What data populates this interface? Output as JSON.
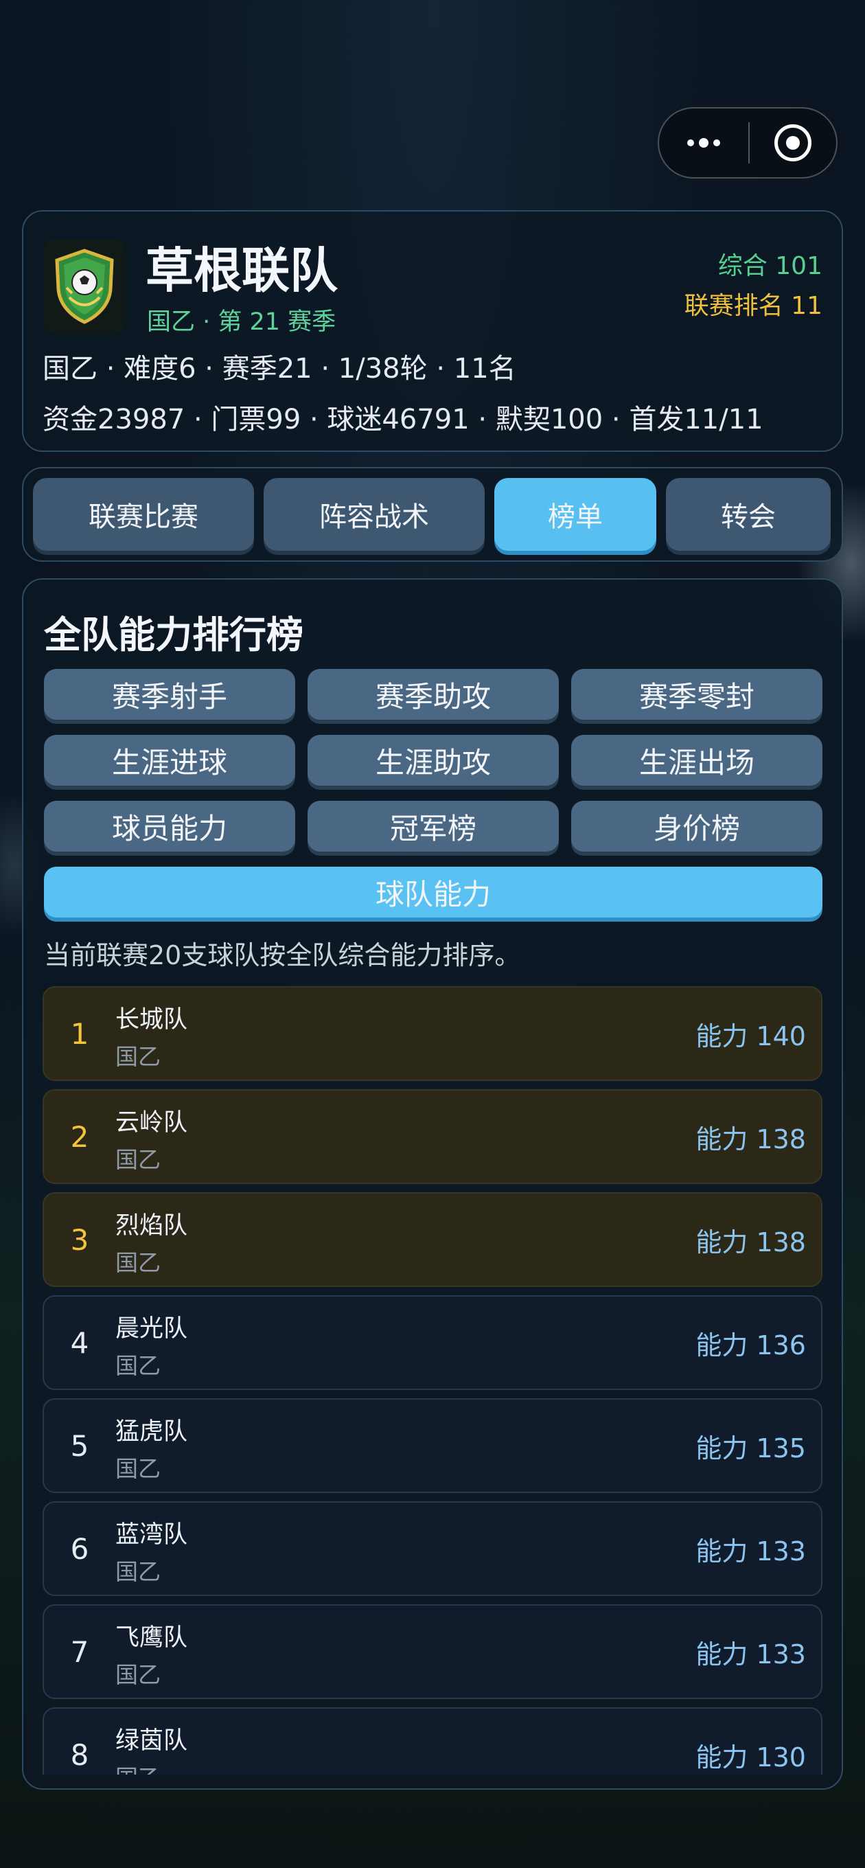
{
  "team": {
    "name": "草根联队",
    "subtitle": "国乙 · 第 21 赛季",
    "rating": "综合 101",
    "league_rank": "联赛排名 11",
    "info_line1": "国乙 · 难度6 · 赛季21 · 1/38轮 · 11名",
    "info_line2": "资金23987 · 门票99 · 球迷46791 · 默契100 · 首发11/11"
  },
  "tabs": [
    {
      "label": "联赛比赛",
      "active": false
    },
    {
      "label": "阵容战术",
      "active": false
    },
    {
      "label": "榜单",
      "active": true
    },
    {
      "label": "转会",
      "active": false
    }
  ],
  "ranking": {
    "title": "全队能力排行榜",
    "categories": [
      {
        "label": "赛季射手"
      },
      {
        "label": "赛季助攻"
      },
      {
        "label": "赛季零封"
      },
      {
        "label": "生涯进球"
      },
      {
        "label": "生涯助攻"
      },
      {
        "label": "生涯出场"
      },
      {
        "label": "球员能力"
      },
      {
        "label": "冠军榜"
      },
      {
        "label": "身价榜"
      }
    ],
    "active_category": "球队能力",
    "description": "当前联赛20支球队按全队综合能力排序。",
    "rows": [
      {
        "rank": "1",
        "name": "长城队",
        "league": "国乙",
        "power": "能力 140"
      },
      {
        "rank": "2",
        "name": "云岭队",
        "league": "国乙",
        "power": "能力 138"
      },
      {
        "rank": "3",
        "name": "烈焰队",
        "league": "国乙",
        "power": "能力 138"
      },
      {
        "rank": "4",
        "name": "晨光队",
        "league": "国乙",
        "power": "能力 136"
      },
      {
        "rank": "5",
        "name": "猛虎队",
        "league": "国乙",
        "power": "能力 135"
      },
      {
        "rank": "6",
        "name": "蓝湾队",
        "league": "国乙",
        "power": "能力 133"
      },
      {
        "rank": "7",
        "name": "飞鹰队",
        "league": "国乙",
        "power": "能力 133"
      },
      {
        "rank": "8",
        "name": "绿茵队",
        "league": "国乙",
        "power": "能力 130"
      }
    ]
  },
  "colors": {
    "accent": "#57c0f0",
    "gold": "#f3c43c",
    "green": "#55d090"
  }
}
